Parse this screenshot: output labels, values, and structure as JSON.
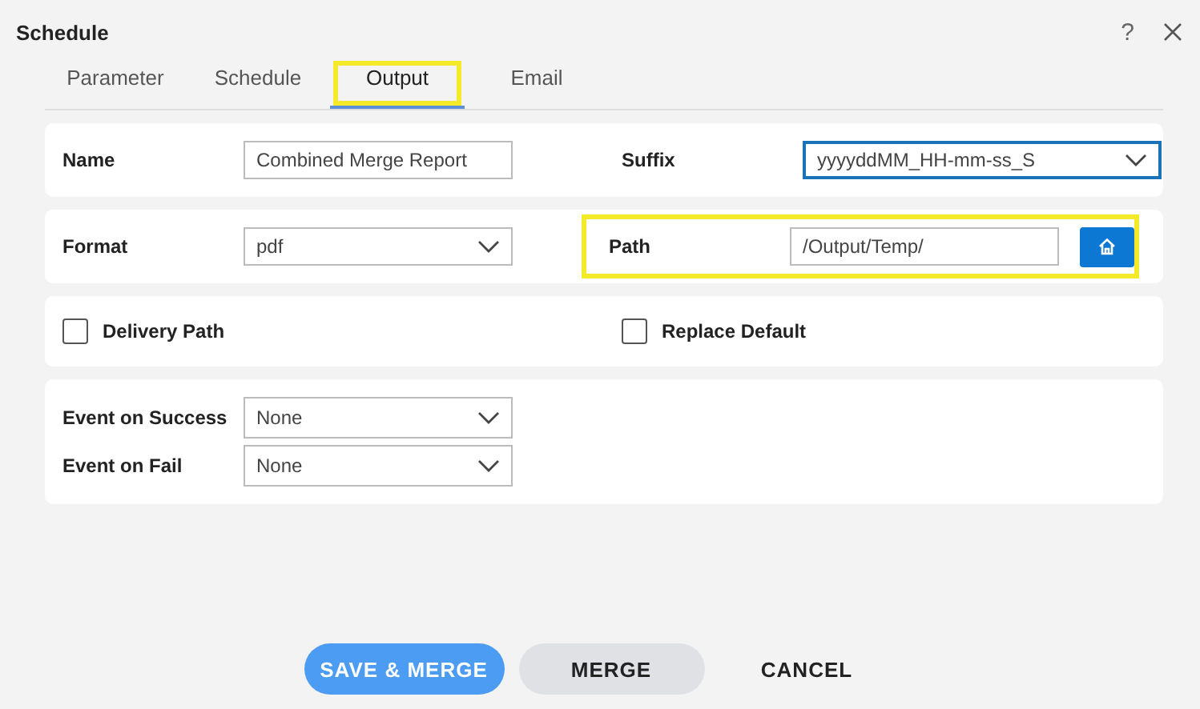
{
  "window": {
    "title": "Schedule",
    "help": "?"
  },
  "tabs": [
    {
      "label": "Parameter",
      "selected": false,
      "highlighted": false
    },
    {
      "label": "Schedule",
      "selected": false,
      "highlighted": false
    },
    {
      "label": "Output",
      "selected": true,
      "highlighted": true
    },
    {
      "label": "Email",
      "selected": false,
      "highlighted": false
    }
  ],
  "name": {
    "label": "Name",
    "value": "Combined Merge Report"
  },
  "suffix": {
    "label": "Suffix",
    "value": "yyyyddMM_HH-mm-ss_S",
    "focused": true
  },
  "format": {
    "label": "Format",
    "value": "pdf",
    "focused": false
  },
  "path": {
    "label": "Path",
    "value": "/Output/Temp/",
    "highlighted": true
  },
  "options": [
    {
      "label": "Delivery Path",
      "checked": false
    },
    {
      "label": "Replace Default",
      "checked": false
    }
  ],
  "events": [
    {
      "label": "Event on Success",
      "value": "None",
      "focused": false
    },
    {
      "label": "Event on Fail",
      "value": "None",
      "focused": false
    }
  ],
  "buttons": [
    {
      "label": "SAVE & MERGE",
      "kind": "primary"
    },
    {
      "label": "MERGE",
      "kind": "secondary"
    },
    {
      "label": "CANCEL",
      "kind": "text"
    }
  ]
}
